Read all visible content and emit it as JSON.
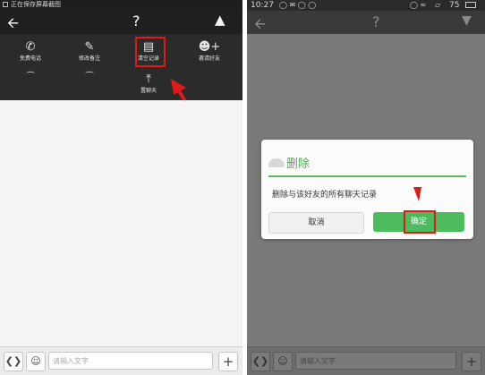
{
  "left": {
    "status_text": "正在保存屏幕截图",
    "title": "?",
    "menu": [
      {
        "label": "免费电话",
        "icon": "phone-icon"
      },
      {
        "label": "修改备注",
        "icon": "edit-icon"
      },
      {
        "label": "清空记录",
        "icon": "trash-icon"
      },
      {
        "label": "邀请好友",
        "icon": "add-friends-icon"
      },
      {
        "label": "",
        "icon": "contact-icon"
      },
      {
        "label": "",
        "icon": "bell-icon"
      },
      {
        "label": "置聊天",
        "icon": "pin-top-icon"
      }
    ],
    "input_placeholder": "请输入文字"
  },
  "right": {
    "status_time": "10:27",
    "status_battery": "75",
    "title": "?",
    "dialog": {
      "title": "删除",
      "message": "删除与该好友的所有聊天记录",
      "cancel_label": "取消",
      "confirm_label": "确定"
    },
    "input_placeholder": "请输入文字"
  },
  "colors": {
    "highlight_red": "#e01a1a",
    "confirm_green": "#4cbb5b",
    "title_green": "#4caf50"
  }
}
